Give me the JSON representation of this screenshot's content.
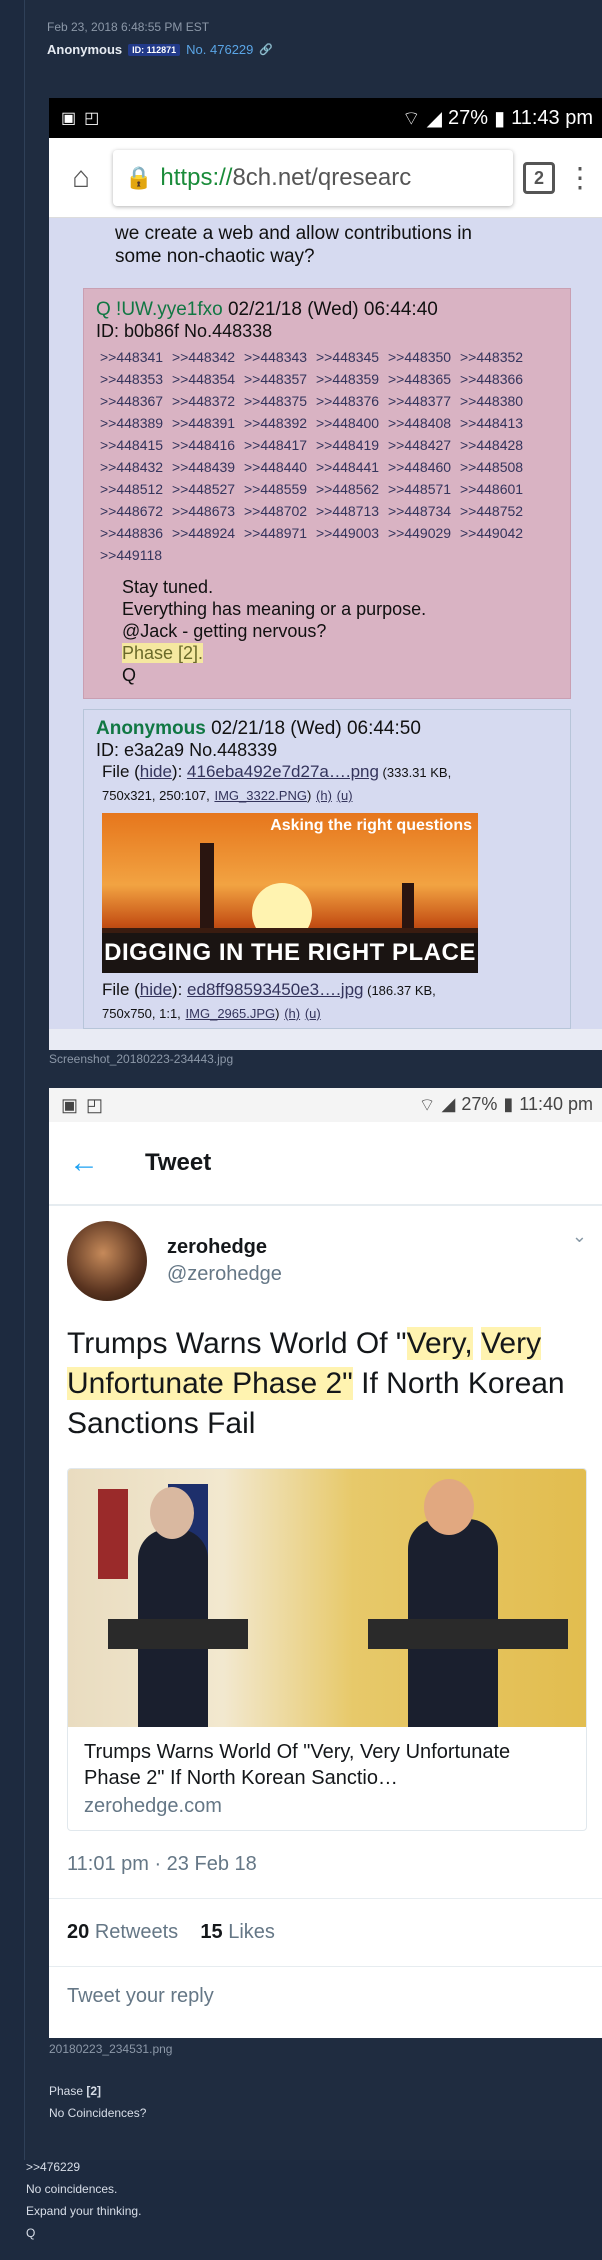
{
  "post": {
    "date": "Feb 23, 2018 6:48:55 PM EST",
    "name": "Anonymous",
    "id": "ID: 112871",
    "number": "No. 476229",
    "link_icon": "link-icon"
  },
  "screenshot1": {
    "status": {
      "battery": "27%",
      "time": "11:43 pm"
    },
    "url": {
      "https": "https://",
      "rest": "8ch.net/qresearc"
    },
    "tabs_count": "2",
    "prev_post_text": [
      "we create a web and allow contributions in",
      "some non-chaotic way?"
    ],
    "q_post": {
      "trip": "Q !UW.yye1fxo",
      "date": "02/21/18 (Wed) 06:44:40",
      "id_line": "ID: b0b86f No.448338",
      "replies": [
        ">>448341",
        ">>448342",
        ">>448343",
        ">>448345",
        ">>448350",
        ">>448352",
        ">>448353",
        ">>448354",
        ">>448357",
        ">>448359",
        ">>448365",
        ">>448366",
        ">>448367",
        ">>448372",
        ">>448375",
        ">>448376",
        ">>448377",
        ">>448380",
        ">>448389",
        ">>448391",
        ">>448392",
        ">>448400",
        ">>448408",
        ">>448413",
        ">>448415",
        ">>448416",
        ">>448417",
        ">>448419",
        ">>448427",
        ">>448428",
        ">>448432",
        ">>448439",
        ">>448440",
        ">>448441",
        ">>448460",
        ">>448508",
        ">>448512",
        ">>448527",
        ">>448559",
        ">>448562",
        ">>448571",
        ">>448601",
        ">>448672",
        ">>448673",
        ">>448702",
        ">>448713",
        ">>448734",
        ">>448752",
        ">>448836",
        ">>448924",
        ">>448971",
        ">>449003",
        ">>449029",
        ">>449042",
        ">>449118"
      ],
      "body": [
        "Stay tuned.",
        "Everything has meaning or a purpose.",
        "@Jack - getting nervous?"
      ],
      "phase": "Phase [2].",
      "sig": "Q"
    },
    "anon_post": {
      "name": "Anonymous",
      "date": "02/21/18 (Wed) 06:44:50",
      "id_line": "ID: e3a2a9 No.448339",
      "file1_prefix": "File (",
      "hide": "hide",
      "file1_name": "416eba492e7d27a….png",
      "file1_meta": " (333.31 KB,",
      "file1_meta2": "750x321, 250:107,",
      "file1_orig": "IMG_3322.PNG",
      "h": "(h)",
      "u": "(u)",
      "image_caption": "DIGGING IN THE RIGHT PLACE",
      "image_top": "Asking the right questions",
      "file2_name": "ed8ff98593450e3….jpg",
      "file2_meta": " (186.37 KB,",
      "file2_meta2": "750x750, 1:1,",
      "file2_orig": "IMG_2965.JPG"
    },
    "filename": "Screenshot_20180223-234443.jpg"
  },
  "screenshot2": {
    "status": {
      "battery": "27%",
      "time": "11:40 pm"
    },
    "header": "Tweet",
    "user": {
      "name": "zerohedge",
      "handle": "@zerohedge"
    },
    "text_a": "Trumps Warns World Of \"",
    "text_hl1": "Very,",
    "text_hl2": "Very Unfortunate Phase 2\"",
    "text_b": " If North Korean Sanctions Fail",
    "card_title": "Trumps Warns World Of \"Very, Very Unfortunate Phase 2\" If North Korean Sanctio…",
    "card_url": "zerohedge.com",
    "time": "11:01 pm · 23 Feb 18",
    "retweets": "20",
    "retweets_label": "Retweets",
    "likes": "15",
    "likes_label": "Likes",
    "reply_placeholder": "Tweet your reply",
    "filename": "20180223_234531.png"
  },
  "comment": {
    "line1_prefix": "Phase ",
    "line1_bold": "[2]",
    "line2": "No Coincidences?"
  },
  "outside": {
    "line1": ">>476229",
    "line2": "No coincidences.",
    "line3": "Expand your thinking.",
    "line4": "Q"
  }
}
